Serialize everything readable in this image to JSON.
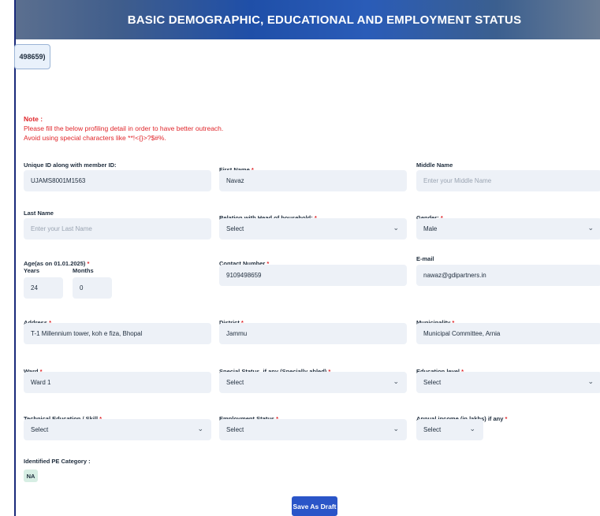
{
  "banner": {
    "title": "BASIC DEMOGRAPHIC, EDUCATIONAL AND EMPLOYMENT STATUS"
  },
  "id_chip": "498659)",
  "note": {
    "title": "Note :",
    "line1": "Please fill the below profiling detail in order to have better outreach.",
    "line2": "Avoid using special characters like **!<{}>?$#%."
  },
  "fields": {
    "unique_id": {
      "label": "Unique ID along with member ID:",
      "value": "UJAMS8001M1563"
    },
    "first_name": {
      "label": "First Name",
      "value": "Navaz"
    },
    "middle_name": {
      "label": "Middle Name",
      "placeholder": "Enter your Middle Name"
    },
    "last_name": {
      "label": "Last Name",
      "placeholder": "Enter your Last Name"
    },
    "relation": {
      "label": "Relation with Head of household:",
      "value": "Select"
    },
    "gender": {
      "label": "Gender:",
      "value": "Male"
    },
    "age": {
      "label": "Age(as on 01.01.2025)",
      "years_label": "Years",
      "months_label": "Months",
      "years": "24",
      "months": "0"
    },
    "contact": {
      "label": "Contact Number",
      "value": "9109498659"
    },
    "email": {
      "label": "E-mail",
      "value": "nawaz@gdipartners.in"
    },
    "address": {
      "label": "Address",
      "value": "T-1 Millennium tower, koh e fiza, Bhopal"
    },
    "district": {
      "label": "District",
      "value": "Jammu"
    },
    "municipality": {
      "label": "Municipality",
      "value": "Municipal Committee, Arnia"
    },
    "ward": {
      "label": "Ward",
      "value": "Ward 1"
    },
    "special_status": {
      "label": "Special Status, if any (Specially abled)",
      "value": "Select"
    },
    "education": {
      "label": "Education level",
      "value": "Select"
    },
    "technical": {
      "label": "Technical Education / Skill",
      "value": "Select"
    },
    "employment": {
      "label": "Employment Status",
      "value": "Select"
    },
    "income": {
      "label": "Annual income (in lakhs) if any",
      "value": "Select"
    },
    "pe_category": {
      "label": "Identified PE Category :",
      "value": "NA"
    }
  },
  "save_label": "Save As Draft",
  "colors": {
    "required": "#e0262b",
    "button": "#2a55c8",
    "input_bg": "#edf1f7"
  }
}
